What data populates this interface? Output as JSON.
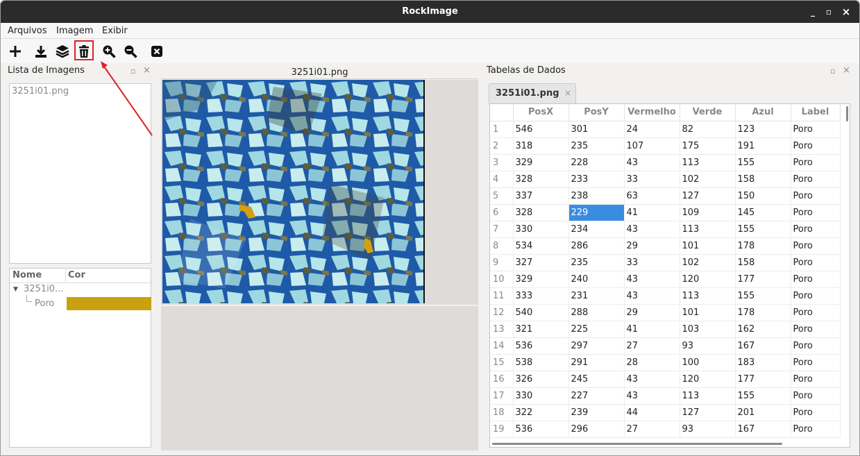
{
  "window": {
    "title": "RockImage",
    "min": "_",
    "max": "▫",
    "close": "×"
  },
  "menu": [
    "Arquivos",
    "Imagem",
    "Exibir"
  ],
  "toolbar": [
    "add-icon",
    "download-icon",
    "layers-icon",
    "trash-icon",
    "zoom-in-icon",
    "zoom-out-icon",
    "close-box-icon"
  ],
  "left_panel": {
    "title": "Lista de Imagens",
    "images": [
      "3251i01.png"
    ],
    "tree": {
      "headers": [
        "Nome",
        "Cor"
      ],
      "root": "3251i0...",
      "child": "Poro",
      "child_color": "#c9a010"
    }
  },
  "center": {
    "title": "3251i01.png"
  },
  "right_panel": {
    "title": "Tabelas de Dados",
    "tab": "3251i01.png",
    "tab_close": "×",
    "columns": [
      "PosX",
      "PosY",
      "Vermelho",
      "Verde",
      "Azul",
      "Label"
    ],
    "rows": [
      [
        "1",
        "546",
        "301",
        "24",
        "82",
        "123",
        "Poro"
      ],
      [
        "2",
        "318",
        "235",
        "107",
        "175",
        "191",
        "Poro"
      ],
      [
        "3",
        "329",
        "228",
        "43",
        "113",
        "155",
        "Poro"
      ],
      [
        "4",
        "328",
        "233",
        "33",
        "102",
        "158",
        "Poro"
      ],
      [
        "5",
        "337",
        "238",
        "63",
        "127",
        "150",
        "Poro"
      ],
      [
        "6",
        "328",
        "229",
        "41",
        "109",
        "145",
        "Poro"
      ],
      [
        "7",
        "330",
        "234",
        "43",
        "113",
        "155",
        "Poro"
      ],
      [
        "8",
        "534",
        "286",
        "29",
        "101",
        "178",
        "Poro"
      ],
      [
        "9",
        "327",
        "235",
        "33",
        "102",
        "158",
        "Poro"
      ],
      [
        "10",
        "329",
        "240",
        "43",
        "120",
        "177",
        "Poro"
      ],
      [
        "11",
        "333",
        "231",
        "43",
        "113",
        "155",
        "Poro"
      ],
      [
        "12",
        "540",
        "288",
        "29",
        "101",
        "178",
        "Poro"
      ],
      [
        "13",
        "321",
        "225",
        "41",
        "103",
        "162",
        "Poro"
      ],
      [
        "14",
        "536",
        "297",
        "27",
        "93",
        "167",
        "Poro"
      ],
      [
        "15",
        "538",
        "291",
        "28",
        "100",
        "183",
        "Poro"
      ],
      [
        "16",
        "326",
        "245",
        "43",
        "120",
        "177",
        "Poro"
      ],
      [
        "17",
        "330",
        "227",
        "43",
        "113",
        "155",
        "Poro"
      ],
      [
        "18",
        "322",
        "239",
        "44",
        "127",
        "201",
        "Poro"
      ],
      [
        "19",
        "536",
        "296",
        "27",
        "93",
        "167",
        "Poro"
      ]
    ]
  }
}
